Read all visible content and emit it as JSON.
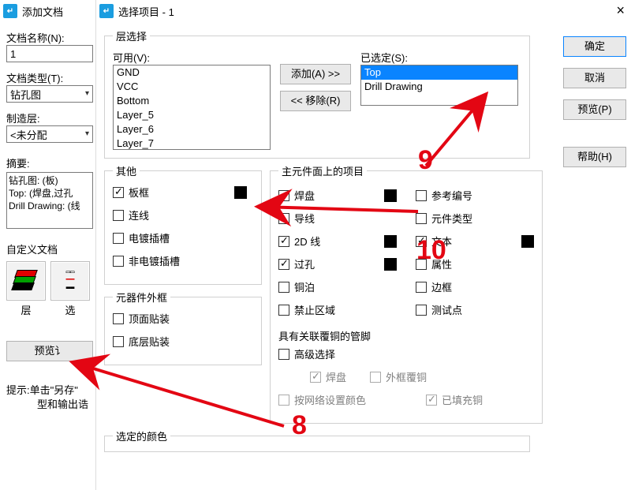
{
  "left": {
    "title": "添加文档",
    "name_label": "文档名称(N):",
    "name_value": "1",
    "type_label": "文档类型(T):",
    "type_value": "钻孔图",
    "mfg_label": "制造层:",
    "mfg_value": "<未分配",
    "summary_label": "摘要:",
    "summary_lines": [
      "钻孔图: (板)",
      "Top: (焊盘,过孔",
      "Drill Drawing: (线"
    ],
    "custom_label": "自定义文档",
    "layer_btn": "层",
    "sel_btn": "选",
    "preview_btn": "预览讠",
    "hint": "提示:单击\"另存\"\n　　　型和输出诰"
  },
  "dlg": {
    "title": "选择项目",
    "suffix": " - 1",
    "close": "×",
    "layer_sel": "层选择",
    "avail": "可用(V):",
    "selected": "已选定(S):",
    "avail_items": [
      "GND",
      "VCC",
      "Bottom",
      "Layer_5",
      "Layer_6",
      "Layer_7"
    ],
    "sel_items": [
      "Top",
      "Drill Drawing"
    ],
    "add_btn": "添加(A) >>",
    "rem_btn": "<< 移除(R)",
    "other": "其他",
    "other_items": {
      "board": "板框",
      "conn": "连线",
      "slot": "电镀插槽",
      "npslot": "非电镀插槽"
    },
    "outline": "元器件外框",
    "outline_items": {
      "top": "顶面贴装",
      "bot": "底层贴装"
    },
    "main": "主元件面上的项目",
    "main_col1": {
      "pad": "焊盘",
      "wire": "导线",
      "d2": "2D 线",
      "via": "过孔",
      "cu": "铜泊",
      "keep": "禁止区域"
    },
    "main_col2": {
      "ref": "参考编号",
      "ptype": "元件类型",
      "text": "文本",
      "attr": "属性",
      "edge": "边框",
      "tp": "测试点"
    },
    "assoc": "具有关联覆铜的管脚",
    "assoc_items": {
      "adv": "高级选择",
      "pad": "焊盘",
      "outline": "外框覆铜",
      "bynet": "按网络设置颜色",
      "filled": "已填充铜"
    },
    "color": "选定的颜色",
    "buttons": {
      "ok": "确定",
      "cancel": "取消",
      "preview": "预览(P)",
      "help": "帮助(H)"
    }
  },
  "anno": {
    "n8": "8",
    "n9": "9",
    "n10": "10"
  }
}
